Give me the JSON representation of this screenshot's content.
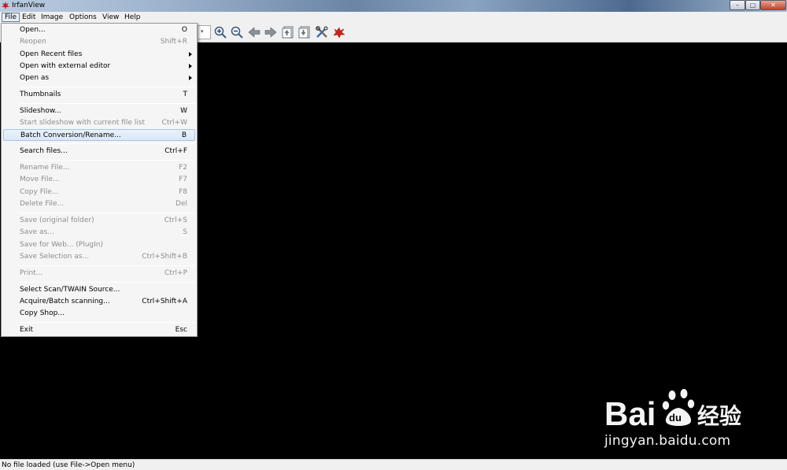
{
  "window": {
    "title": "IrfanView",
    "min_glyph": "–",
    "max_glyph": "▢",
    "close_glyph": "✕"
  },
  "menubar": {
    "items": [
      "File",
      "Edit",
      "Image",
      "Options",
      "View",
      "Help"
    ]
  },
  "toolbar": {
    "zoom_dropdown_glyph": "▾",
    "icons": [
      "zoom-in-icon",
      "zoom-out-icon",
      "previous-arrow-icon",
      "next-arrow-icon",
      "first-file-icon",
      "last-file-icon",
      "settings-tools-icon",
      "irfanview-cat-icon"
    ]
  },
  "file_menu": {
    "items": [
      {
        "label": "Open...",
        "shortcut": "O",
        "disabled": false
      },
      {
        "label": "Reopen",
        "shortcut": "Shift+R",
        "disabled": true
      },
      {
        "label": "Open Recent files",
        "shortcut": "",
        "disabled": false,
        "submenu": true
      },
      {
        "label": "Open with external editor",
        "shortcut": "",
        "disabled": false,
        "submenu": true
      },
      {
        "label": "Open as",
        "shortcut": "",
        "disabled": false,
        "submenu": true
      },
      {
        "label": "Thumbnails",
        "shortcut": "T",
        "disabled": false
      },
      {
        "label": "Slideshow...",
        "shortcut": "W",
        "disabled": false
      },
      {
        "label": "Start slideshow with current file list",
        "shortcut": "Ctrl+W",
        "disabled": true
      },
      {
        "label": "Batch Conversion/Rename...",
        "shortcut": "B",
        "disabled": false,
        "highlighted": true
      },
      {
        "label": "Search files...",
        "shortcut": "Ctrl+F",
        "disabled": false
      },
      {
        "label": "Rename File...",
        "shortcut": "F2",
        "disabled": true
      },
      {
        "label": "Move File...",
        "shortcut": "F7",
        "disabled": true
      },
      {
        "label": "Copy File...",
        "shortcut": "F8",
        "disabled": true
      },
      {
        "label": "Delete File...",
        "shortcut": "Del",
        "disabled": true
      },
      {
        "label": "Save (original folder)",
        "shortcut": "Ctrl+S",
        "disabled": true
      },
      {
        "label": "Save as...",
        "shortcut": "S",
        "disabled": true
      },
      {
        "label": "Save for Web... (PlugIn)",
        "shortcut": "",
        "disabled": true
      },
      {
        "label": "Save Selection as...",
        "shortcut": "Ctrl+Shift+B",
        "disabled": true
      },
      {
        "label": "Print...",
        "shortcut": "Ctrl+P",
        "disabled": true
      },
      {
        "label": "Select Scan/TWAIN Source...",
        "shortcut": "",
        "disabled": false
      },
      {
        "label": "Acquire/Batch scanning...",
        "shortcut": "Ctrl+Shift+A",
        "disabled": false
      },
      {
        "label": "Copy Shop...",
        "shortcut": "",
        "disabled": false
      },
      {
        "label": "Exit",
        "shortcut": "Esc",
        "disabled": false
      }
    ]
  },
  "status": {
    "text": "No file loaded (use File->Open menu)"
  },
  "watermark": {
    "brand_left": "Bai",
    "brand_right": "经验",
    "url": "jingyan.baidu.com"
  },
  "colors": {
    "background": "#000000",
    "chrome": "#f0f0f0",
    "menu": "#f5f5f5",
    "highlight_border": "#a8c4e4",
    "disabled_text": "#8d8d8d"
  }
}
